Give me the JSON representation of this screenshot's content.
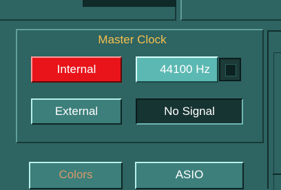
{
  "master_clock": {
    "title": "Master Clock",
    "internal_label": "Internal",
    "external_label": "External",
    "sample_rate": "44100 Hz",
    "signal_status": "No Signal"
  },
  "bottom": {
    "colors_label": "Colors",
    "asio_label": "ASIO"
  },
  "colors": {
    "background": "#2e6462",
    "title_color": "#f4c050",
    "active_red": "#e8141a",
    "disabled_text": "#d59a6a"
  }
}
